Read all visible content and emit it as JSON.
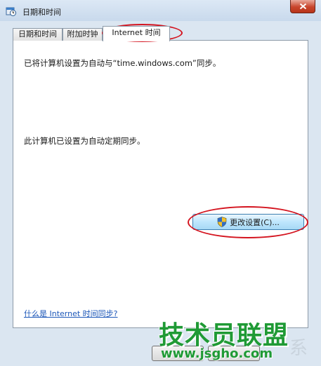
{
  "window": {
    "title": "日期和时间"
  },
  "tabs": [
    {
      "label": "日期和时间"
    },
    {
      "label": "附加时钟"
    },
    {
      "label": "Internet 时间",
      "selected": true
    }
  ],
  "panel": {
    "sync_message": "已将计算机设置为自动与“time.windows.com”同步。",
    "scheduled_message": "此计算机已设置为自动定期同步。",
    "change_settings_label": "更改设置(C)...",
    "help_link": "什么是 Internet 时间同步?"
  },
  "watermark": {
    "brand": "技术员联盟",
    "url": "www.jsgho.com",
    "ghost": "系"
  },
  "colors": {
    "annotation": "#d4141f",
    "link": "#1b56b8",
    "watermark": "#1f9a35",
    "close": "#c8452c"
  },
  "icons": {
    "title": "clock-calendar-icon",
    "button": "uac-shield-icon",
    "close": "close-icon"
  }
}
